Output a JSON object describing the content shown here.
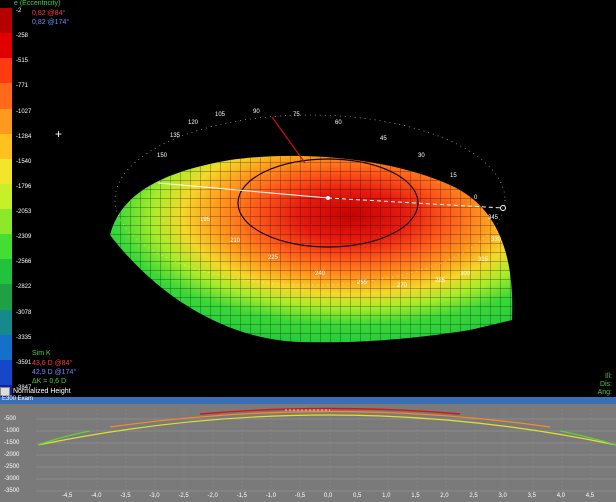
{
  "legend": {
    "title": "e (Eccentricity)",
    "value1": "0,82 @84°",
    "value2": "0,82 @174°",
    "title_color": "#3cd24c",
    "value1_color": "#ff3a3a",
    "value2_color": "#6b8cff"
  },
  "scale": {
    "labels": [
      "-2",
      "-258",
      "-515",
      "-771",
      "-1027",
      "-1284",
      "-1540",
      "-1796",
      "-2053",
      "-2309",
      "-2566",
      "-2822",
      "-3078",
      "-3335",
      "-3591",
      "-3847"
    ],
    "colors": [
      "#b50000",
      "#e00000",
      "#ff3a12",
      "#ff6a1a",
      "#ff9a1e",
      "#ffc11e",
      "#f2e52a",
      "#c8f028",
      "#8ee82a",
      "#45dc34",
      "#22c23c",
      "#1fa046",
      "#168a8a",
      "#1470c8",
      "#1448c8",
      "#0e22a8"
    ]
  },
  "simk": {
    "title": "Sim K",
    "k1": "43,6 D @84°",
    "k2": "42,9 D @174°",
    "dk": "ΔK = 0,6 D"
  },
  "normalized_height_label": "Normalized Height",
  "right_info": {
    "line1": "Ill:",
    "line2": "Dis:",
    "line3": "Ang:"
  },
  "axis_angles": [
    "105",
    "90",
    "75",
    "60",
    "45",
    "120",
    "135",
    "150",
    "30",
    "15",
    "0",
    "345",
    "330",
    "195",
    "210",
    "225",
    "240",
    "255",
    "270",
    "285",
    "300",
    "315"
  ],
  "profile": {
    "title": "E300 Exam",
    "y_ticks": [
      "-500",
      "-1000",
      "-1500",
      "-2000",
      "-2500",
      "-3000",
      "-3500"
    ],
    "x_ticks": [
      "-4,5",
      "-4,0",
      "-3,5",
      "-3,0",
      "-2,5",
      "-2,0",
      "-1,5",
      "-1,0",
      "-0,5",
      "0,0",
      "0,5",
      "1,0",
      "1,5",
      "2,0",
      "2,5",
      "3,0",
      "3,5",
      "4,0",
      "4,5"
    ]
  }
}
